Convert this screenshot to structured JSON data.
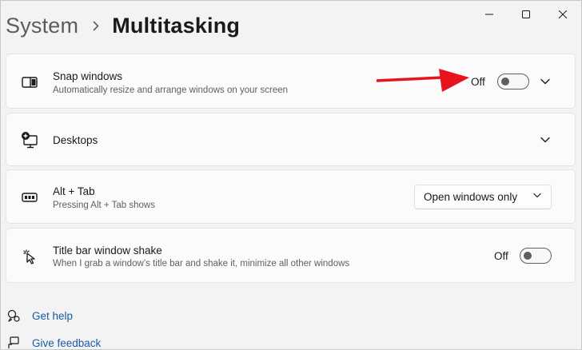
{
  "breadcrumb": {
    "parent": "System",
    "current": "Multitasking"
  },
  "window_controls": [
    "minimize-icon",
    "maximize-icon",
    "close-icon"
  ],
  "settings": [
    {
      "icon": "snap-windows-icon",
      "title": "Snap windows",
      "description": "Automatically resize and arrange windows on your screen",
      "state": "Off",
      "toggle_on": false,
      "expandable": true
    },
    {
      "icon": "desktops-icon",
      "title": "Desktops",
      "expandable": true
    },
    {
      "icon": "alt-tab-icon",
      "title": "Alt + Tab",
      "description": "Pressing Alt + Tab shows",
      "dropdown_value": "Open windows only"
    },
    {
      "icon": "window-shake-icon",
      "title": "Title bar window shake",
      "description": "When I grab a window’s title bar and shake it, minimize all other windows",
      "state": "Off",
      "toggle_on": false
    }
  ],
  "links": [
    {
      "icon": "help-icon",
      "label": "Get help"
    },
    {
      "icon": "feedback-icon",
      "label": "Give feedback"
    }
  ],
  "annotation": {
    "arrow_color": "#e8141c"
  }
}
